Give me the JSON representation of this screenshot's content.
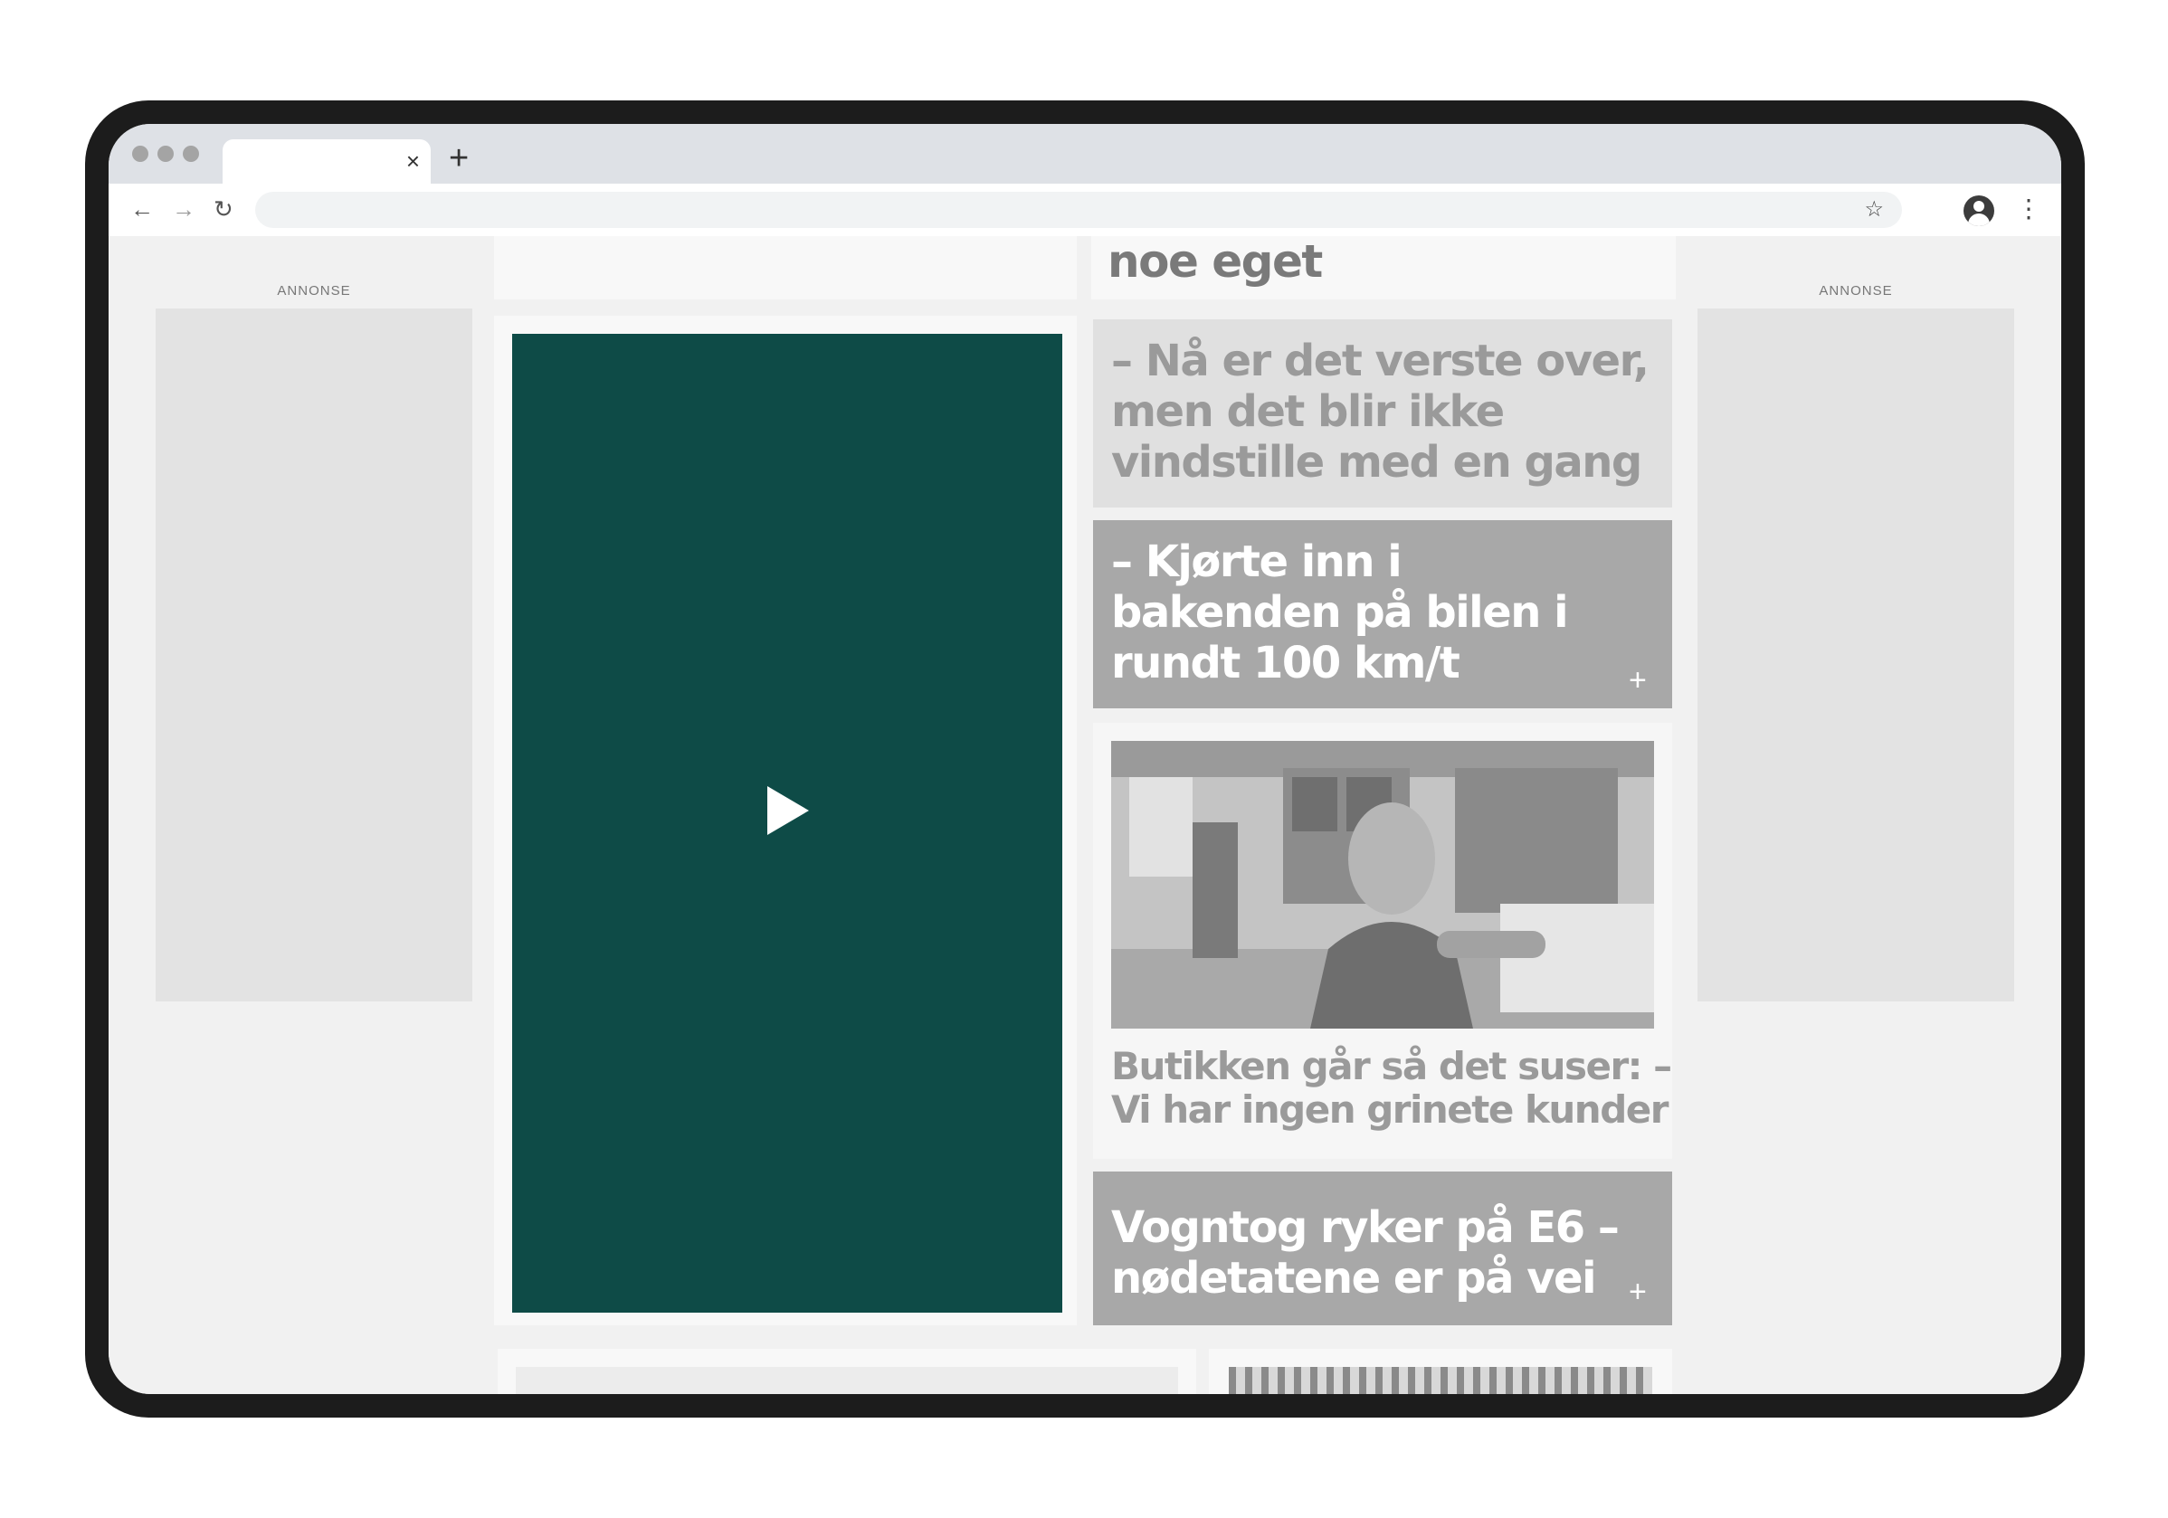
{
  "browser": {
    "tab_close": "×",
    "new_tab": "+",
    "back": "←",
    "forward": "→",
    "reload": "↻",
    "bookmark": "☆",
    "menu": "⋮"
  },
  "ads": {
    "left_label": "ANNONSE",
    "right_label": "ANNONSE"
  },
  "articles": [
    {
      "headline": "noe eget"
    },
    {
      "headline": "– Nå er det verste over, men det blir ikke vindstille med en gang"
    },
    {
      "headline": "– Kjørte inn i bakenden på bilen i rundt 100 km/t",
      "plus": "+"
    },
    {
      "headline": "Butikken går så det suser: – Vi har ingen grinete kunder",
      "image": "joker-store-owner-photo"
    },
    {
      "headline": "Vogntog ryker på E6 – nødetatene er på vei",
      "plus": "+"
    }
  ],
  "colors": {
    "video_background": "#0e4b47",
    "teaser_gray": "#a8a8a8",
    "teaser_light": "#e0e0e0",
    "headline_gray": "#9a9a9a"
  },
  "icons": [
    "play-icon",
    "plus-icon",
    "back-icon",
    "forward-icon",
    "reload-icon",
    "star-icon",
    "account-icon",
    "more-icon",
    "close-icon"
  ]
}
